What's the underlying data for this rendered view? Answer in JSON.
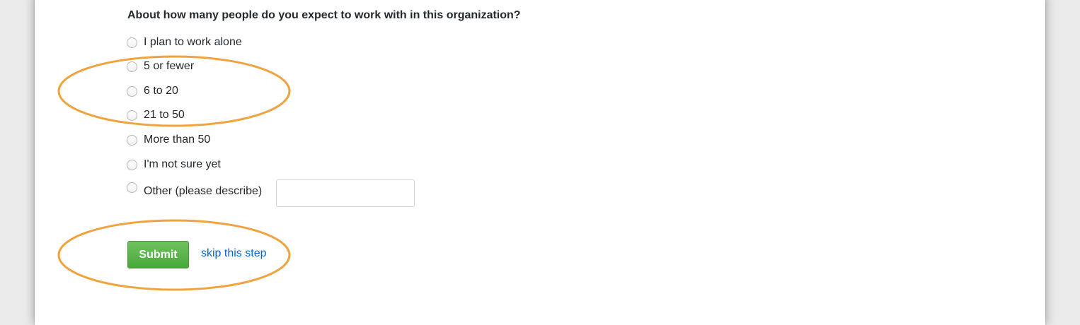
{
  "survey": {
    "question": "About how many people do you expect to work with in this organization?",
    "options": [
      {
        "label": "I plan to work alone"
      },
      {
        "label": "5 or fewer"
      },
      {
        "label": "6 to 20"
      },
      {
        "label": "21 to 50"
      },
      {
        "label": "More than 50"
      },
      {
        "label": "I'm not sure yet"
      },
      {
        "label": "Other (please describe)"
      }
    ],
    "other_input_value": "",
    "submit_label": "Submit",
    "skip_label": "skip this step"
  },
  "colors": {
    "annotation": "#f0a23c",
    "submit_green": "#5cb04a",
    "link_blue": "#0366d6"
  }
}
